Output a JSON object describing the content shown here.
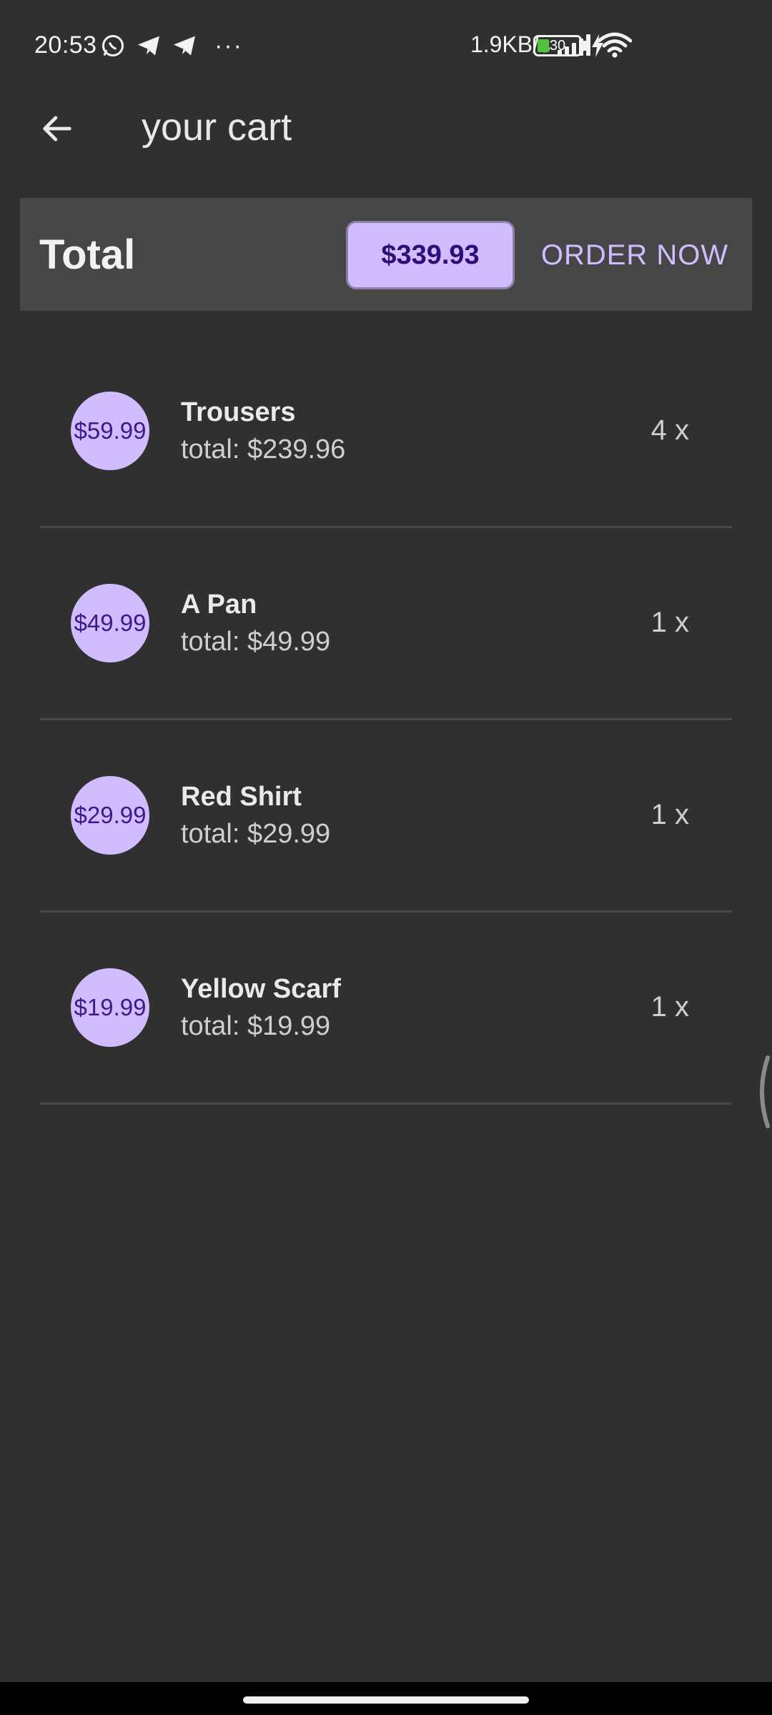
{
  "status_bar": {
    "time": "20:53",
    "net_speed": "1.9KB/s",
    "battery": "30",
    "icons": [
      "whatsapp-icon",
      "telegram-icon",
      "telegram-icon",
      "more-dots-icon",
      "signal-icon",
      "wifi-icon",
      "battery-icon",
      "charging-icon"
    ],
    "more": "···"
  },
  "app_bar": {
    "back_icon": "arrow-left-icon",
    "title": "your cart"
  },
  "total_card": {
    "label": "Total",
    "amount": "$339.93",
    "order_button": "ORDER NOW"
  },
  "cart_items": [
    {
      "price": "$59.99",
      "name": "Trousers",
      "total": "total: $239.96",
      "qty": "4 x"
    },
    {
      "price": "$49.99",
      "name": "A Pan",
      "total": "total: $49.99",
      "qty": "1 x"
    },
    {
      "price": "$29.99",
      "name": "Red Shirt",
      "total": "total: $29.99",
      "qty": "1 x"
    },
    {
      "price": "$19.99",
      "name": "Yellow Scarf",
      "total": "total: $19.99",
      "qty": "1 x"
    }
  ],
  "colors": {
    "background": "#303030",
    "card": "#464646",
    "accent": "#d0bcff",
    "accent_text": "#2e0f7a"
  }
}
